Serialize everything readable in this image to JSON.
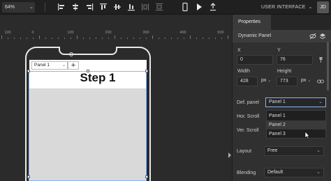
{
  "toolbar": {
    "zoom_value": "64%",
    "mode_label": "USER INTERFACE",
    "avatar_initials": "JD",
    "icons": [
      "align-left-icon",
      "align-center-h-icon",
      "align-right-icon",
      "align-top-icon",
      "align-middle-v-icon",
      "align-bottom-icon",
      "distribute-h-icon",
      "distribute-v-icon",
      "phone-preview-icon",
      "play-icon",
      "export-icon"
    ]
  },
  "ruler": {
    "labels": [
      "100",
      "0",
      "100",
      "200",
      "300",
      "400",
      "500"
    ]
  },
  "canvas": {
    "panel_select_value": "Panel 1",
    "add_panel_label": "+",
    "step_title": "Step 1"
  },
  "properties": {
    "tab_label": "Properties",
    "component_name": "Dynamic Panel",
    "x_label": "X",
    "x_value": "0",
    "y_label": "Y",
    "y_value": "76",
    "width_label": "Width",
    "width_value": "428",
    "width_unit": "px",
    "height_label": "Height",
    "height_value": "773",
    "height_unit": "px",
    "def_panel_label": "Def. panel",
    "def_panel_value": "Panel 1",
    "def_panel_options": [
      "Panel 1",
      "Panel 2",
      "Panel 3"
    ],
    "hor_scroll_label": "Hor. Scroll",
    "ver_scroll_label": "Ver. Scroll",
    "layout_label": "Layout",
    "layout_value": "Free",
    "blending_label": "Blending",
    "blending_value": "Default"
  },
  "colors": {
    "accent": "#8ab4f8",
    "toolbar_bg": "#202020",
    "canvas_bg": "#2b2b2b",
    "panel_bg": "#303030"
  }
}
